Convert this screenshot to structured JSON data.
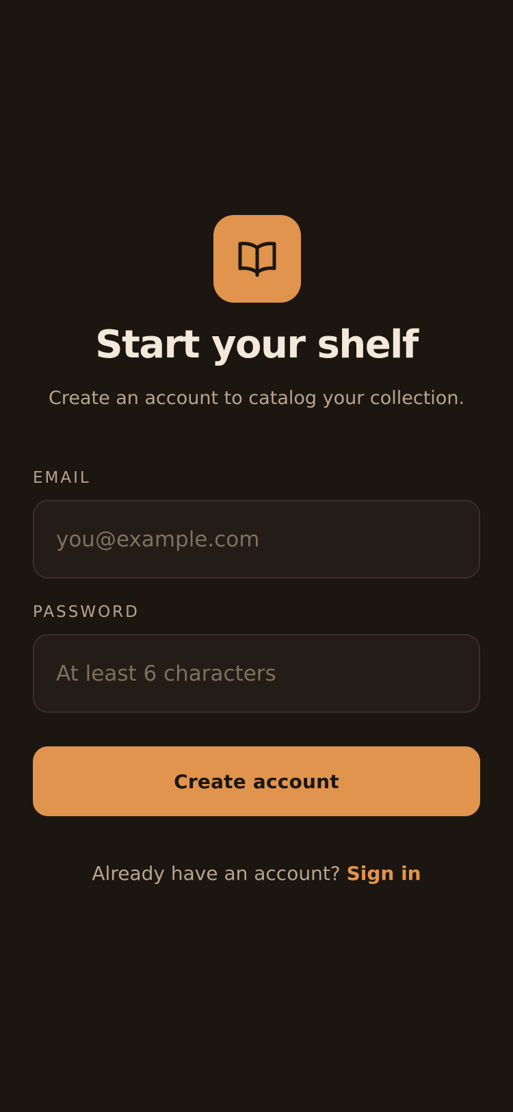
{
  "colors": {
    "background": "#1c1611",
    "accent": "#e0944d",
    "title": "#f3e8d9",
    "muted": "#b8a48f",
    "input_bg": "#241c16",
    "input_border": "#3b3027",
    "placeholder": "#7f705f"
  },
  "logo": {
    "icon": "open-book-icon"
  },
  "header": {
    "title": "Start your shelf",
    "subtitle": "Create an account to catalog your collection."
  },
  "form": {
    "email": {
      "label": "EMAIL",
      "value": "",
      "placeholder": "you@example.com"
    },
    "password": {
      "label": "PASSWORD",
      "value": "",
      "placeholder": "At least 6 characters"
    },
    "submit_label": "Create account"
  },
  "footer": {
    "prompt": "Already have an account?",
    "link_label": "Sign in"
  }
}
